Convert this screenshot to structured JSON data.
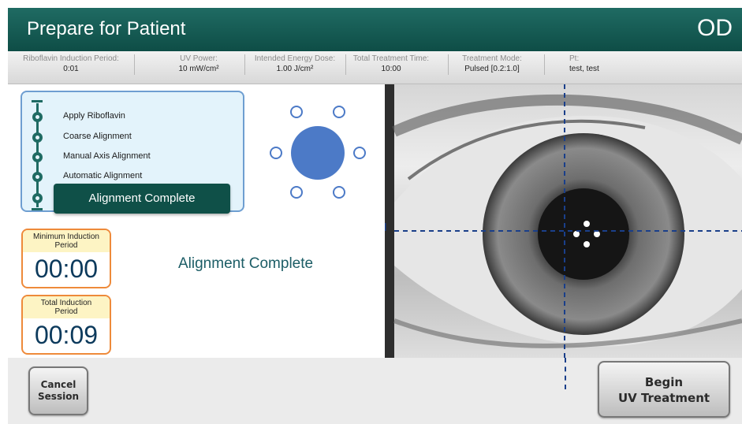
{
  "header": {
    "title": "Prepare for Patient",
    "eye": "OD"
  },
  "info": [
    {
      "label": "Riboflavin Induction Period:",
      "value": "0:01"
    },
    {
      "label": "UV Power:",
      "value": "10 mW/cm²"
    },
    {
      "label": "Intended Energy Dose:",
      "value": "1.00 J/cm²"
    },
    {
      "label": "Total Treatment Time:",
      "value": "10:00"
    },
    {
      "label": "Treatment Mode:",
      "value": "Pulsed [0.2:1.0]"
    },
    {
      "label": "Pt:",
      "value": "test, test"
    }
  ],
  "steps": [
    "Apply Riboflavin",
    "Coarse Alignment",
    "Manual Axis Alignment",
    "Automatic Alignment"
  ],
  "active_step": "Alignment Complete",
  "timers": {
    "minimum": {
      "label_line1": "Minimum Induction",
      "label_line2": "Period",
      "time": "00:00"
    },
    "total": {
      "label_line1": "Total Induction",
      "label_line2": "Period",
      "time": "00:09"
    }
  },
  "status_text": "Alignment Complete",
  "buttons": {
    "cancel_line1": "Cancel",
    "cancel_line2": "Session",
    "begin_line1": "Begin",
    "begin_line2": "UV Treatment"
  },
  "colors": {
    "header": "#0e4d46",
    "accent": "#4c7ac7",
    "timer_border": "#ee8a3a",
    "crosshair": "#1a3f8a"
  },
  "icons": {
    "fixation": "fixation-target-icon",
    "progress_track": "progress-track-icon"
  }
}
